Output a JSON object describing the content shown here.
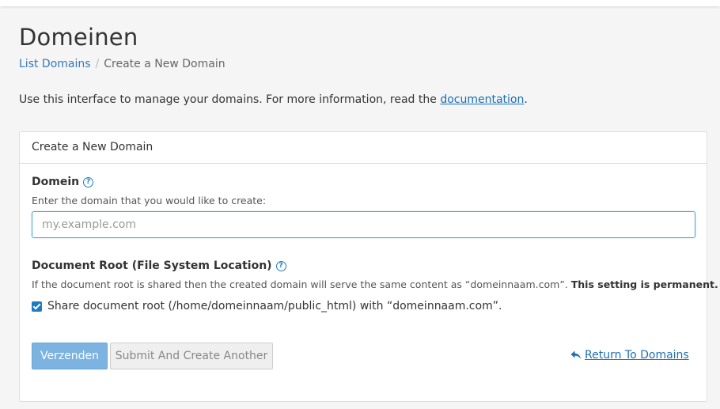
{
  "page": {
    "title": "Domeinen"
  },
  "breadcrumb": {
    "link": "List Domains",
    "separator": "/",
    "current": "Create a New Domain"
  },
  "intro": {
    "text": "Use this interface to manage your domains. For more information, read the ",
    "link": "documentation",
    "end": "."
  },
  "panel": {
    "heading": "Create a New Domain",
    "domain": {
      "label": "Domein",
      "help": "Enter the domain that you would like to create:",
      "placeholder": "my.example.com",
      "value": ""
    },
    "docroot": {
      "label": "Document Root (File System Location)",
      "help": "If the document root is shared then the created domain will serve the same content as “domeinnaam.com”. ",
      "help_bold": "This setting is permanent.",
      "checkbox_label": "Share document root (/home/domeinnaam/public_html) with “domeinnaam.com”.",
      "checked": true
    },
    "buttons": {
      "submit": "Verzenden",
      "submit_another": "Submit And Create Another",
      "return": "Return To Domains"
    }
  },
  "icons": {
    "help": "question-circle-icon",
    "return": "reply-arrow-icon",
    "checkbox": "checkbox-checked-icon"
  },
  "colors": {
    "accent": "#1f7bc1",
    "link": "#337ab7",
    "primary_button": "#7cb3e0"
  }
}
